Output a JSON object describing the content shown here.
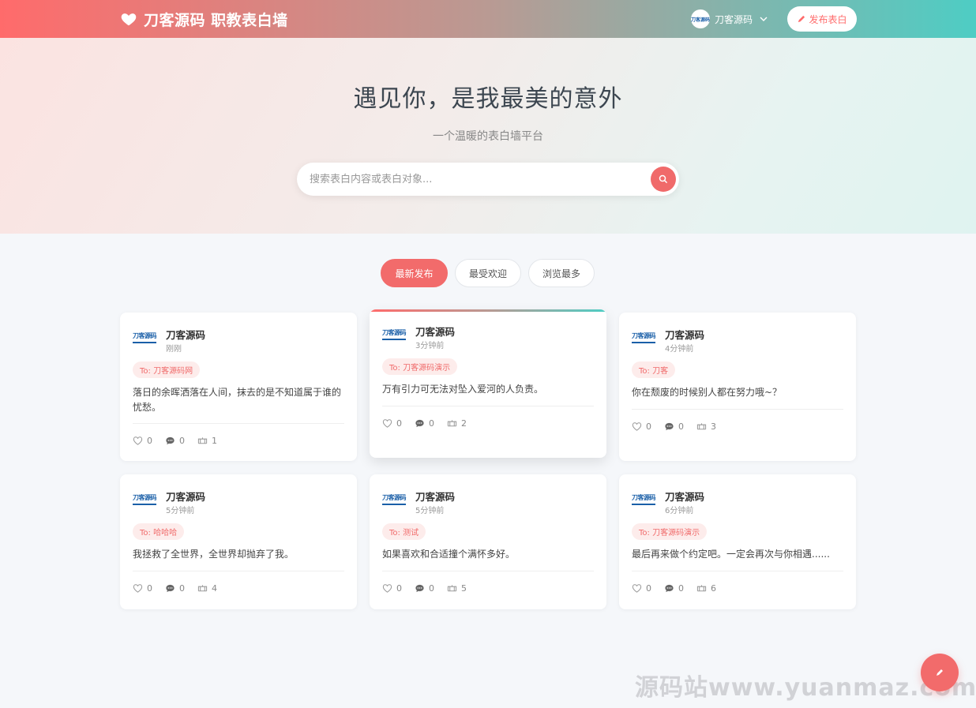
{
  "header": {
    "brand_title": "刀客源码 职教表白墙",
    "user_name": "刀客源码",
    "avatar_text": "刀客源码",
    "publish_label": "发布表白"
  },
  "hero": {
    "title": "遇见你，是我最美的意外",
    "subtitle": "一个温暖的表白墙平台",
    "search_placeholder": "搜索表白内容或表白对象..."
  },
  "tabs": [
    {
      "label": "最新发布",
      "active": true
    },
    {
      "label": "最受欢迎",
      "active": false
    },
    {
      "label": "浏览最多",
      "active": false
    }
  ],
  "cards": [
    {
      "logo": "刀客源码",
      "user": "刀客源码",
      "time": "刚刚",
      "to": "To: 刀客源码网",
      "content": "落日的余晖洒落在人间，抹去的是不知道属于谁的忧愁。",
      "likes": "0",
      "comments": "0",
      "views": "1"
    },
    {
      "logo": "刀客源码",
      "user": "刀客源码",
      "time": "3分钟前",
      "to": "To: 刀客源码演示",
      "content": "万有引力可无法对坠入爱河的人负责。",
      "likes": "0",
      "comments": "0",
      "views": "2"
    },
    {
      "logo": "刀客源码",
      "user": "刀客源码",
      "time": "4分钟前",
      "to": "To: 刀客",
      "content": "你在颓废的时候别人都在努力哦~？",
      "likes": "0",
      "comments": "0",
      "views": "3"
    },
    {
      "logo": "刀客源码",
      "user": "刀客源码",
      "time": "5分钟前",
      "to": "To: 哈哈哈",
      "content": "我拯救了全世界，全世界却抛弃了我。",
      "likes": "0",
      "comments": "0",
      "views": "4"
    },
    {
      "logo": "刀客源码",
      "user": "刀客源码",
      "time": "5分钟前",
      "to": "To: 测试",
      "content": "如果喜欢和合适撞个满怀多好。",
      "likes": "0",
      "comments": "0",
      "views": "5"
    },
    {
      "logo": "刀客源码",
      "user": "刀客源码",
      "time": "6分钟前",
      "to": "To: 刀客源码演示",
      "content": "最后再来做个约定吧。一定会再次与你相遇......",
      "likes": "0",
      "comments": "0",
      "views": "6"
    }
  ],
  "watermark": "源码站www.yuanmaz.com",
  "colors": {
    "accent": "#f26b6b",
    "teal": "#4ecdc4"
  }
}
